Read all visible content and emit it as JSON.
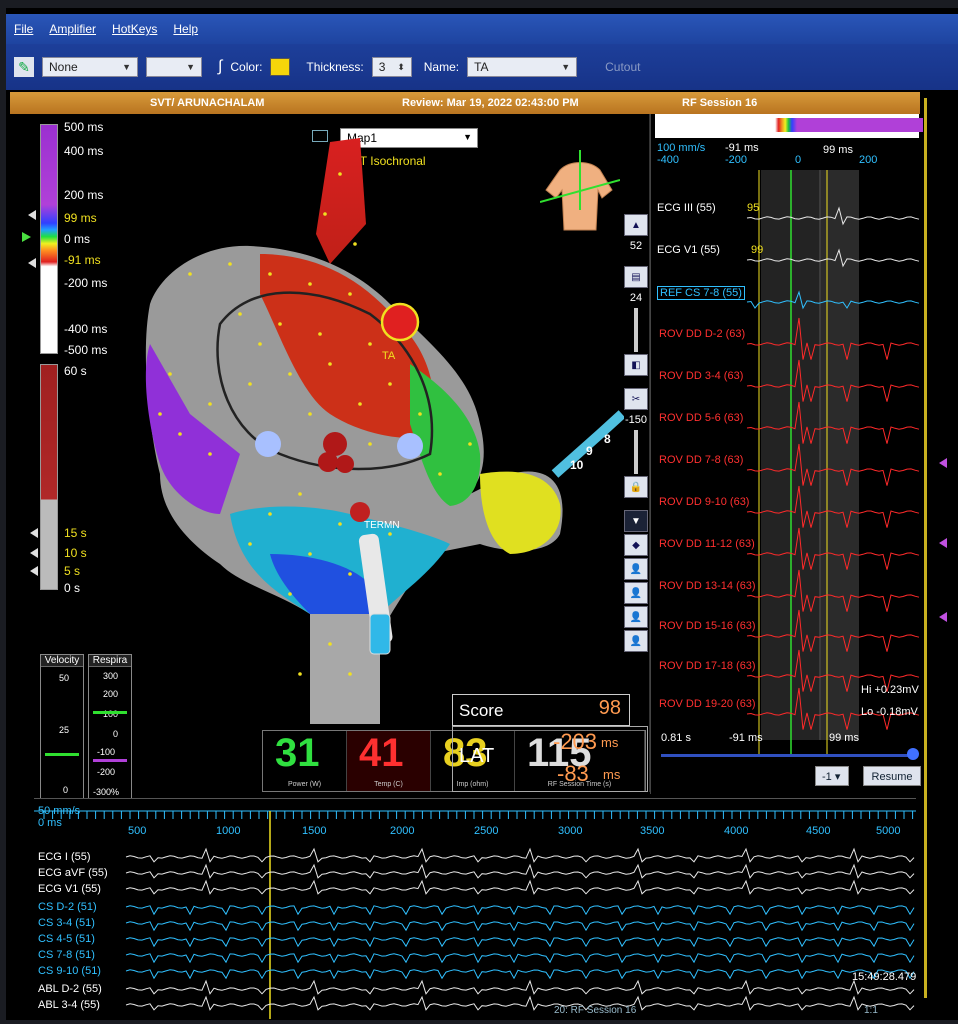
{
  "menu": {
    "file": "File",
    "amplifier": "Amplifier",
    "hotkeys": "HotKeys",
    "help": "Help"
  },
  "toolbar": {
    "style_value": "None",
    "color_label": "Color:",
    "thickness_label": "Thickness:",
    "thickness_value": "3",
    "name_label": "Name:",
    "name_value": "TA",
    "cutout_label": "Cutout",
    "color_value": "#f5d50a"
  },
  "header": {
    "patient": "SVT/ ARUNACHALAM",
    "review": "Review: Mar 19, 2022 02:43:00 PM",
    "session": "RF Session 16"
  },
  "lat_scale": {
    "labels": [
      "500 ms",
      "400 ms",
      "200 ms",
      "99 ms",
      "0 ms",
      "-91 ms",
      "-200 ms",
      "-400 ms",
      "-500 ms"
    ]
  },
  "time_scale": {
    "labels": [
      "60 s",
      "15 s",
      "10 s",
      "5 s",
      "0 s"
    ]
  },
  "map": {
    "selector": "Map1",
    "type": "LAT Isochronal",
    "label_ta": "TA",
    "label_termn": "TERMN",
    "catheter_marks": [
      "10",
      "9",
      "8"
    ]
  },
  "tools": {
    "val1": "52",
    "val2": "24",
    "val3": "-150"
  },
  "gauges": {
    "velocity": {
      "title": "Velocity",
      "labels": [
        "50",
        "25",
        "0"
      ]
    },
    "respiration": {
      "title": "Respira",
      "labels": [
        "300",
        "200",
        "100",
        "0",
        "-100",
        "-200",
        "-300%"
      ]
    }
  },
  "stats": {
    "power": {
      "value": "31",
      "label": "Power (W)"
    },
    "temp": {
      "value": "41",
      "label": "Temp (C)"
    },
    "imp": {
      "value": "83",
      "label": "Imp (ohm)"
    },
    "rf_time": {
      "value": "115",
      "label": "RF Session Time (s)"
    }
  },
  "score": {
    "label": "Score",
    "value": "98"
  },
  "lat_box": {
    "label": "LAT",
    "v1": "-203",
    "v2": "-83",
    "unit": "ms"
  },
  "ecg_right": {
    "speed": "100 mm/s",
    "markers": [
      "-91 ms",
      "99 ms"
    ],
    "axis": [
      "-400",
      "-200",
      "0",
      "200"
    ],
    "channels": [
      {
        "name": "ECG III (55)",
        "val": "95",
        "color": "w"
      },
      {
        "name": "ECG V1 (55)",
        "val": "99",
        "color": "w"
      },
      {
        "name": "REF CS  7-8 (55)",
        "val": "",
        "color": "c"
      },
      {
        "name": "ROV DD  D-2 (63)",
        "val": "",
        "color": "r"
      },
      {
        "name": "ROV DD  3-4 (63)",
        "val": "",
        "color": "r"
      },
      {
        "name": "ROV DD  5-6 (63)",
        "val": "",
        "color": "r"
      },
      {
        "name": "ROV DD  7-8 (63)",
        "val": "",
        "color": "r"
      },
      {
        "name": "ROV DD  9-10 (63)",
        "val": "",
        "color": "r"
      },
      {
        "name": "ROV DD  11-12 (63)",
        "val": "",
        "color": "r"
      },
      {
        "name": "ROV DD  13-14 (63)",
        "val": "",
        "color": "r"
      },
      {
        "name": "ROV DD  15-16 (63)",
        "val": "",
        "color": "r"
      },
      {
        "name": "ROV DD  17-18 (63)",
        "val": "",
        "color": "r"
      },
      {
        "name": "ROV DD  19-20 (63)",
        "val": "",
        "color": "r"
      }
    ],
    "hi": "Hi +0.23mV",
    "lo": "Lo -0.18mV",
    "footer_time": "0.81 s",
    "footer_m1": "-91 ms",
    "footer_m2": "99 ms",
    "minus_value": "-1",
    "resume": "Resume"
  },
  "ecg_bottom": {
    "speed": "50 mm/s",
    "zero": "0 ms",
    "ticks": [
      "500",
      "1000",
      "1500",
      "2000",
      "2500",
      "3000",
      "3500",
      "4000",
      "4500",
      "5000"
    ],
    "channels": [
      {
        "name": "ECG I (55)",
        "color": "w"
      },
      {
        "name": "ECG aVF (55)",
        "color": "w"
      },
      {
        "name": "ECG V1 (55)",
        "color": "w"
      },
      {
        "name": "CS  D-2 (51)",
        "color": "c"
      },
      {
        "name": "CS  3-4 (51)",
        "color": "c"
      },
      {
        "name": "CS  4-5 (51)",
        "color": "c"
      },
      {
        "name": "CS  7-8 (51)",
        "color": "c"
      },
      {
        "name": "CS  9-10 (51)",
        "color": "c"
      },
      {
        "name": "ABL  D-2 (55)",
        "color": "w"
      },
      {
        "name": "ABL  3-4 (55)",
        "color": "w"
      }
    ],
    "timestamp": "15:49:28.479",
    "footer": "20: RF Session 16",
    "ratio": "1:1"
  }
}
